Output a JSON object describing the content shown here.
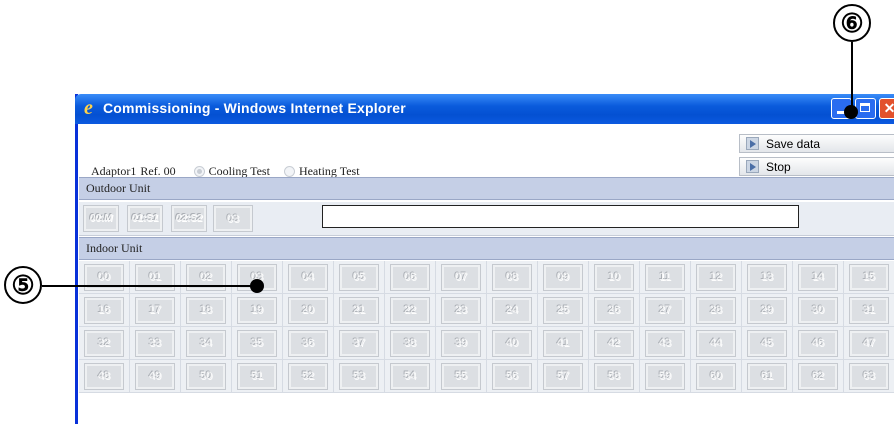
{
  "window": {
    "title": "Commissioning - Windows Internet Explorer",
    "close_glyph": "✕"
  },
  "callouts": {
    "six": "⑥",
    "five": "⑤"
  },
  "adaptor": {
    "name": "Adaptor1",
    "ref": "Ref. 00",
    "cooling_label": "Cooling Test",
    "heating_label": "Heating Test",
    "selected": "Cooling Test"
  },
  "actions": {
    "save_label": "Save data",
    "stop_label": "Stop"
  },
  "outdoor": {
    "header": "Outdoor Unit",
    "units": [
      "00:M",
      "01:S1",
      "02:S2",
      "03"
    ],
    "status_text": ""
  },
  "indoor": {
    "header": "Indoor Unit",
    "units": [
      "00",
      "01",
      "02",
      "03",
      "04",
      "05",
      "06",
      "07",
      "08",
      "09",
      "10",
      "11",
      "12",
      "13",
      "14",
      "15",
      "16",
      "17",
      "18",
      "19",
      "20",
      "21",
      "22",
      "23",
      "24",
      "25",
      "26",
      "27",
      "28",
      "29",
      "30",
      "31",
      "32",
      "33",
      "34",
      "35",
      "36",
      "37",
      "38",
      "39",
      "40",
      "41",
      "42",
      "43",
      "44",
      "45",
      "46",
      "47",
      "48",
      "49",
      "50",
      "51",
      "52",
      "53",
      "54",
      "55",
      "56",
      "57",
      "58",
      "59",
      "60",
      "61",
      "62",
      "63"
    ]
  },
  "icons": {
    "ie": "ie-logo-icon",
    "play": "play-icon"
  }
}
